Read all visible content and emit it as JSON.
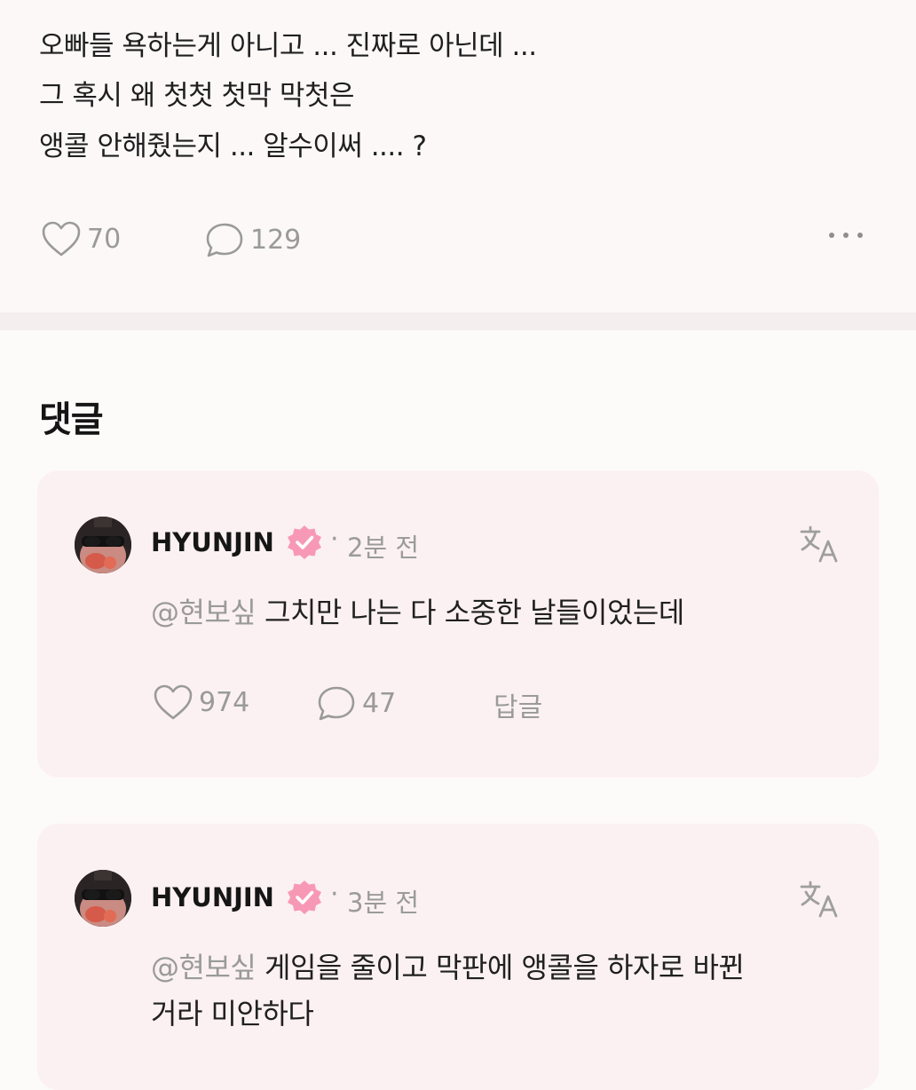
{
  "post": {
    "lines": [
      "오빠들 욕하는게 아니고 ... 진짜로 아닌데 ...",
      "그 혹시 왜 첫첫 첫막 막첫은",
      "앵콜 안해줬는지 ... 알수이써 .... ?"
    ],
    "likes": "70",
    "comments": "129",
    "like_icon": "heart-icon",
    "comment_icon": "speech-bubble-icon",
    "more_icon": "more-dots-icon"
  },
  "comments_section": {
    "title": "댓글",
    "items": [
      {
        "author": "HYUNJIN",
        "time": "2분 전",
        "mention": "@현보싶",
        "text": " 그치만 나는 다 소중한 날들이었는데",
        "text_line2": "",
        "likes": "974",
        "replies": "47",
        "reply_label": "답글"
      },
      {
        "author": "HYUNJIN",
        "time": "3분 전",
        "mention": "@현보싶",
        "text": " 게임을 줄이고 막판에 앵콜을 하자로 바뀐",
        "text_line2": "거라 미안하다"
      }
    ],
    "separator": "·"
  },
  "colors": {
    "accent_badge": "#f799b5",
    "card_bg": "#fcf1f2",
    "muted_text": "#9a9a9a"
  }
}
